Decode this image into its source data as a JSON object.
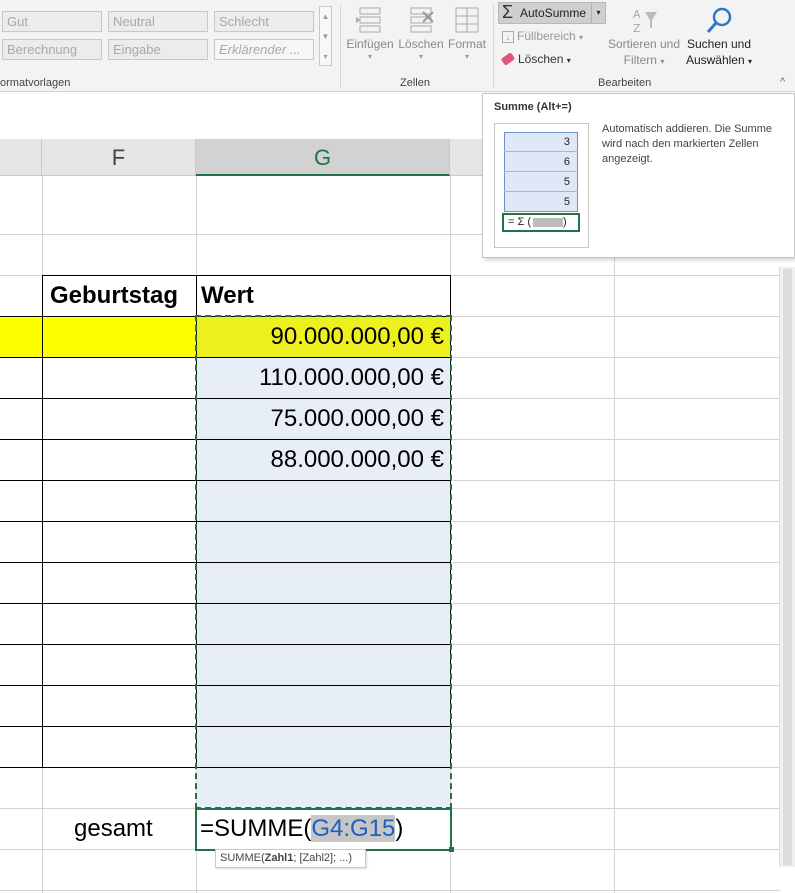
{
  "ribbon": {
    "styles": {
      "row1": [
        "Gut",
        "Neutral",
        "Schlecht"
      ],
      "row2": [
        "Berechnung",
        "Eingabe",
        "Erklärender ..."
      ],
      "group_label": "ormatvorlagen"
    },
    "cells_group": {
      "label": "Zellen",
      "buttons": [
        {
          "label": "Einfügen",
          "icon": "insert-cells-icon"
        },
        {
          "label": "Löschen",
          "icon": "delete-cells-icon"
        },
        {
          "label": "Format",
          "icon": "format-cells-icon"
        }
      ]
    },
    "editing_group": {
      "label": "Bearbeiten",
      "autosum": "AutoSumme",
      "fill": "Füllbereich",
      "clear": "Löschen",
      "sort_line1": "Sortieren und",
      "sort_line2": "Filtern",
      "find_line1": "Suchen und",
      "find_line2": "Auswählen"
    },
    "collapse_glyph": "^"
  },
  "tooltip": {
    "title": "Summe (Alt+=)",
    "description": "Automatisch addieren. Die Summe wird nach den markierten Zellen angezeigt.",
    "illustration": {
      "values": [
        "3",
        "6",
        "5",
        "5"
      ],
      "formula": "= Σ ("
    }
  },
  "sheet": {
    "columns": {
      "f": "F",
      "g": "G"
    },
    "headers": {
      "birthday": "Geburtstag",
      "value": "Wert"
    },
    "values": [
      "90.000.000,00 €",
      "110.000.000,00 €",
      "75.000.000,00 €",
      "88.000.000,00 €"
    ],
    "total_label": "gesamt",
    "formula": {
      "prefix": "=SUMME(",
      "range": "G4:G15",
      "suffix": ")"
    },
    "hint": {
      "func": "SUMME(",
      "arg1": "Zahl1",
      "rest": "; [Zahl2]; ...)"
    }
  },
  "colors": {
    "highlight_yellow": "#ffff00",
    "selection_fill": "#e8eef7",
    "excel_green": "#217346",
    "range_blue": "#1f5fbf"
  }
}
